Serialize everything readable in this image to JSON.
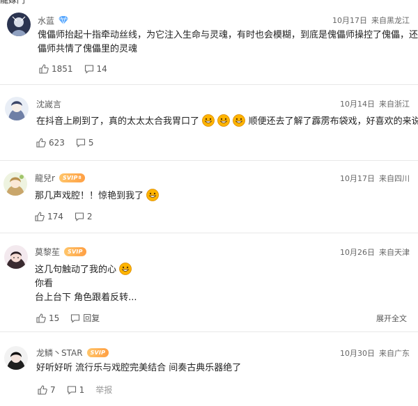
{
  "top_cut_text": "龍嫁鬥",
  "comments": [
    {
      "username": "水蓝",
      "date": "10月17日",
      "location": "来自黑龙江",
      "lines": [
        "傀儡师抬起十指牵动丝线，为它注入生命与灵魂，有时也会模糊，到底是傀儡师操控了傀儡，还是傀",
        "儡师共情了傀儡里的灵魂"
      ],
      "likes": "1851",
      "replies": "14"
    },
    {
      "username": "沈嵗言",
      "date": "10月14日",
      "location": "来自浙江",
      "line_before": "在抖音上刷到了，真的太太太合我胃口了",
      "line_after": "顺便还去了解了霹雳布袋戏，好喜欢的来说",
      "likes": "623",
      "replies": "5"
    },
    {
      "username": "龍兒r",
      "badge": "SVIP",
      "badge_level": "8",
      "date": "10月17日",
      "location": "来自四川",
      "line": "那几声戏腔！！惊艳到我了",
      "likes": "174",
      "replies": "2"
    },
    {
      "username": "莫黎苼",
      "badge": "SVIP",
      "date": "10月26日",
      "location": "来自天津",
      "lines": [
        "这几句触动了我的心",
        "你看",
        "台上台下 角色跟着反转..."
      ],
      "likes": "15",
      "reply_label": "回复",
      "expand_label": "展开全文"
    },
    {
      "username": "龙鳞丶STAR",
      "badge": "SVIP",
      "date": "10月30日",
      "location": "来自广东",
      "line": "好听好听 流行乐与戏腔完美结合 间奏古典乐器绝了",
      "likes": "7",
      "replies": "1",
      "reply_label": "举报"
    }
  ],
  "colors": {
    "svip_badge": "#ff9f43",
    "verified_badge": "#5aa9ff",
    "emoji": "#ffb400"
  }
}
